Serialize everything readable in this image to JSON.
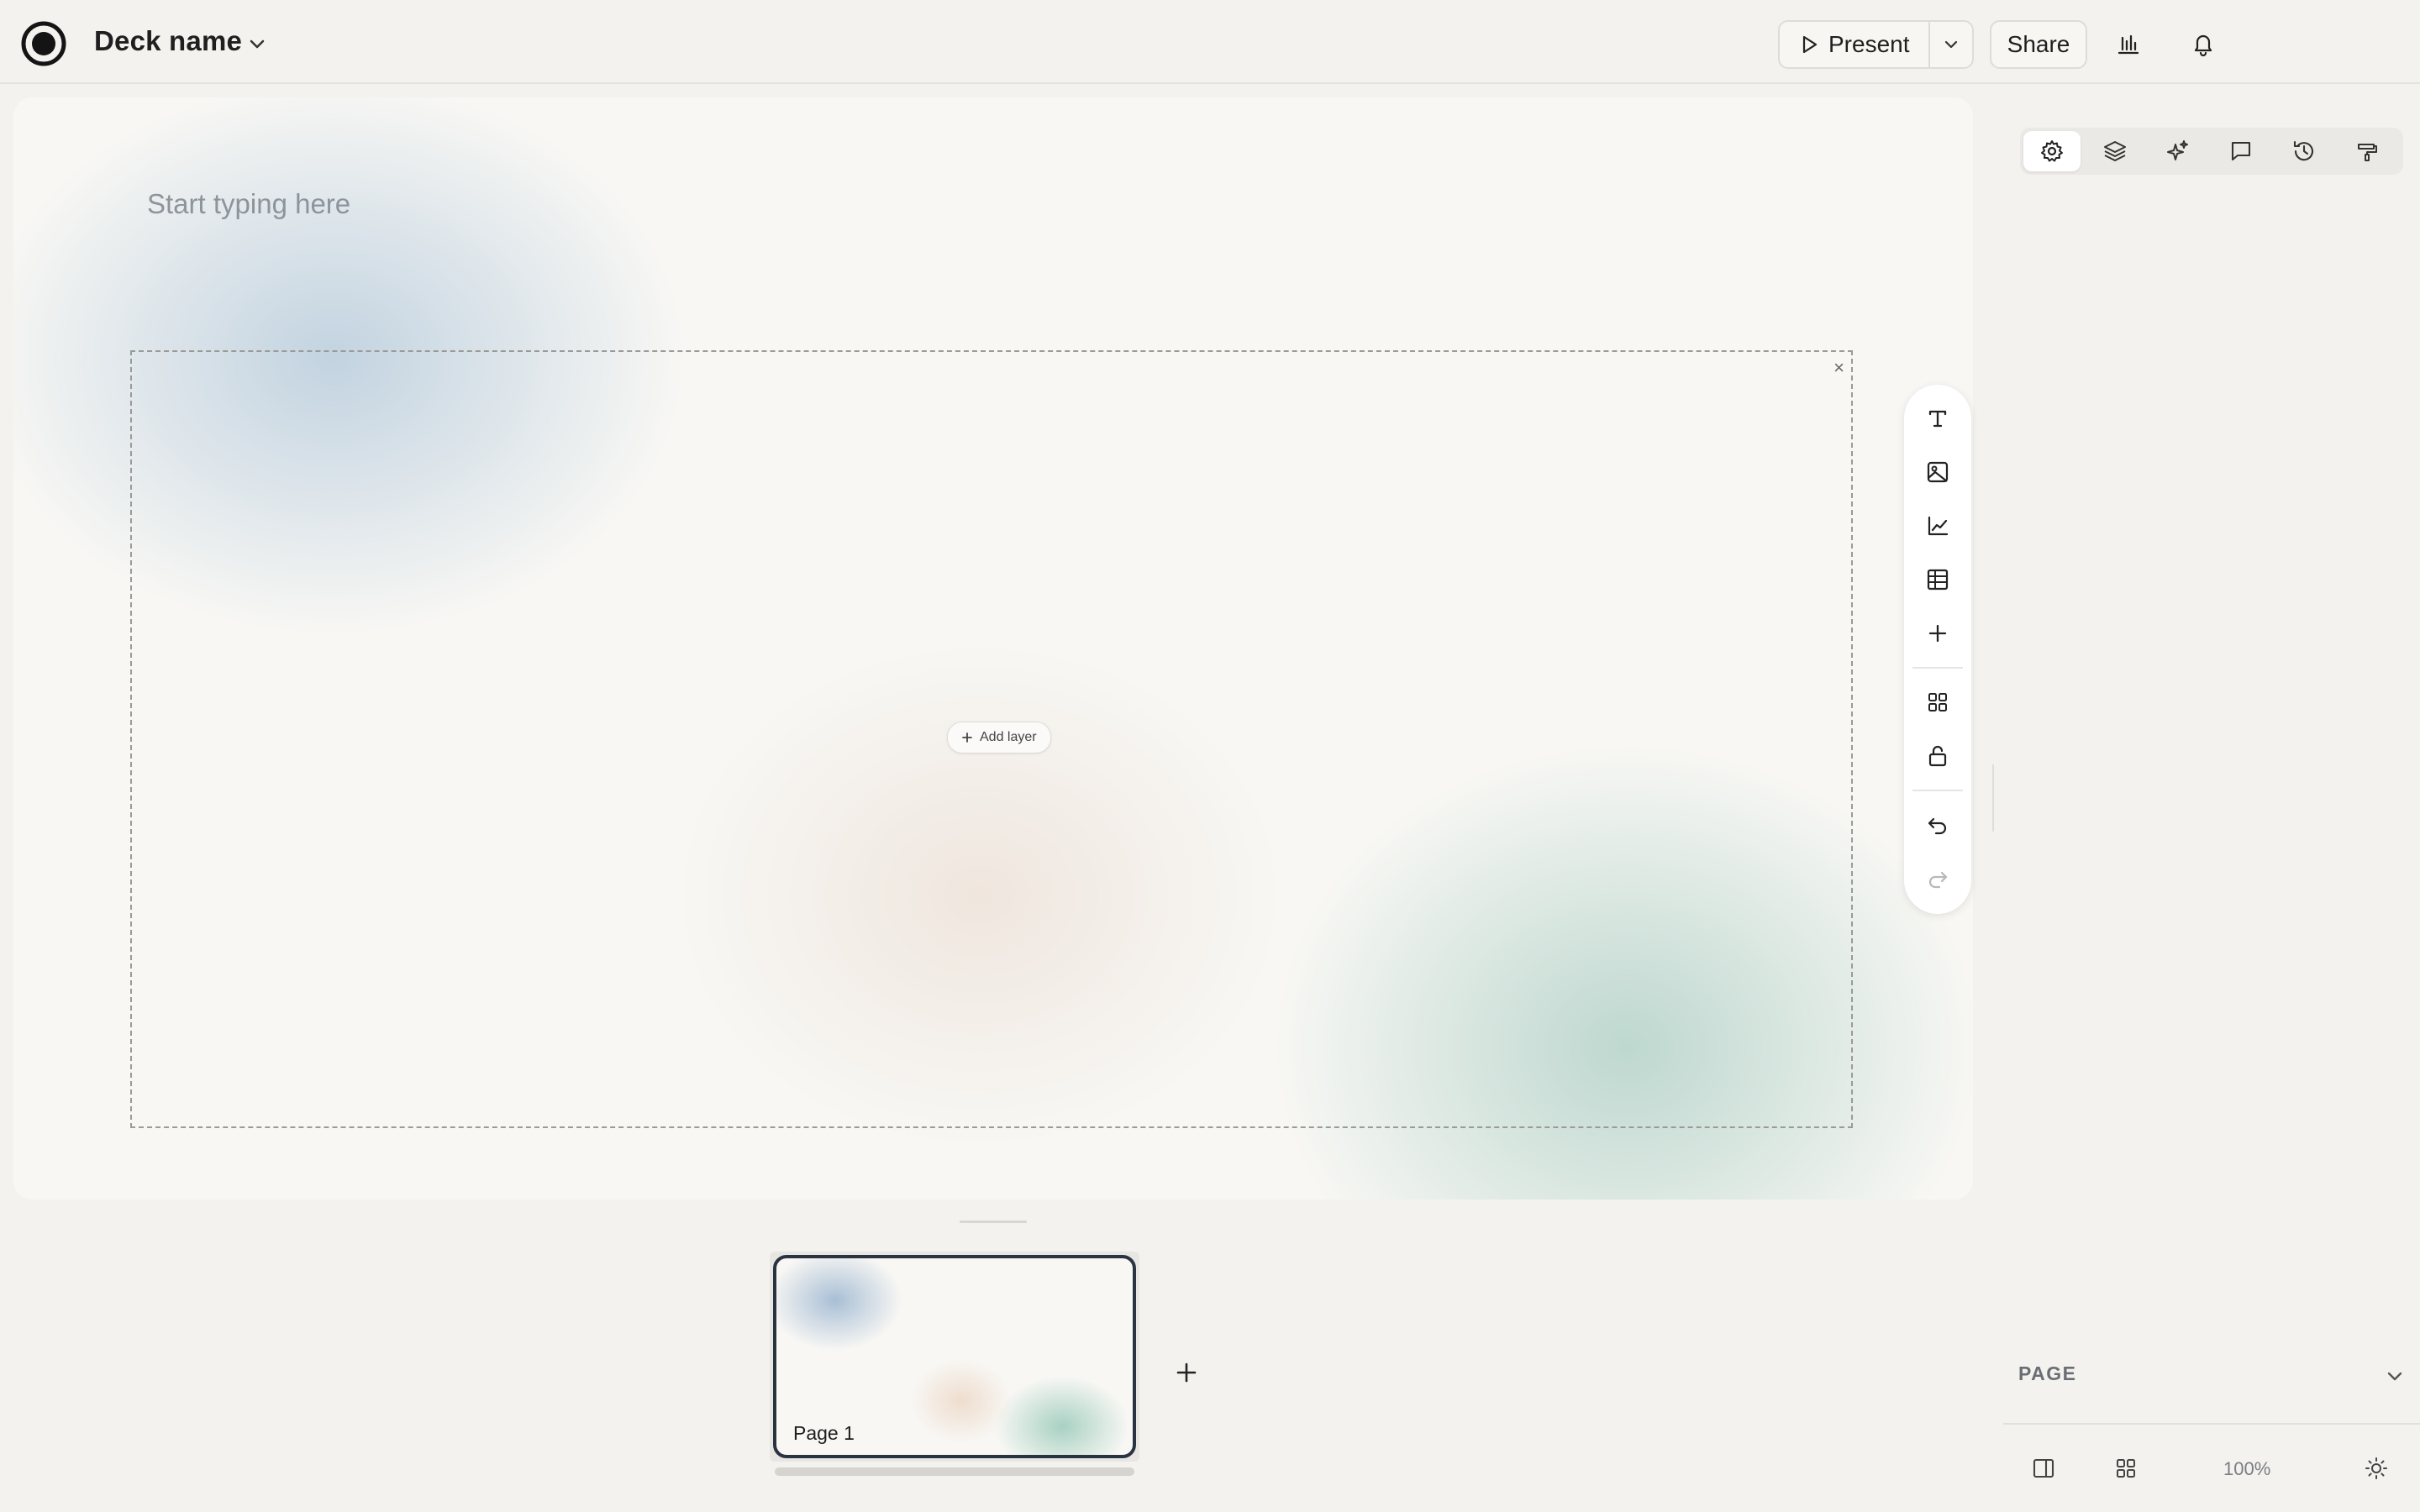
{
  "header": {
    "deck_name": "Deck name",
    "present_label": "Present",
    "share_label": "Share",
    "icons": [
      "logo-icon",
      "chevron-down-icon",
      "play-icon",
      "analytics-icon",
      "bell-icon"
    ]
  },
  "canvas": {
    "placeholder": "Start typing here",
    "add_layer_label": "Add layer",
    "close_symbol": "×"
  },
  "toolbar": {
    "tools": [
      "text-icon",
      "image-icon",
      "chart-icon",
      "table-icon",
      "plus-icon",
      "grid-icon",
      "unlock-icon",
      "undo-icon",
      "redo-icon"
    ]
  },
  "panel": {
    "tabs": [
      "settings-icon",
      "layers-icon",
      "sparkles-icon",
      "comment-icon",
      "history-icon",
      "paint-icon"
    ],
    "active_tab": "settings-icon",
    "page_section_title": "PAGE",
    "zoom": "100%"
  },
  "pages": [
    {
      "label": "Page 1",
      "selected": true
    }
  ]
}
